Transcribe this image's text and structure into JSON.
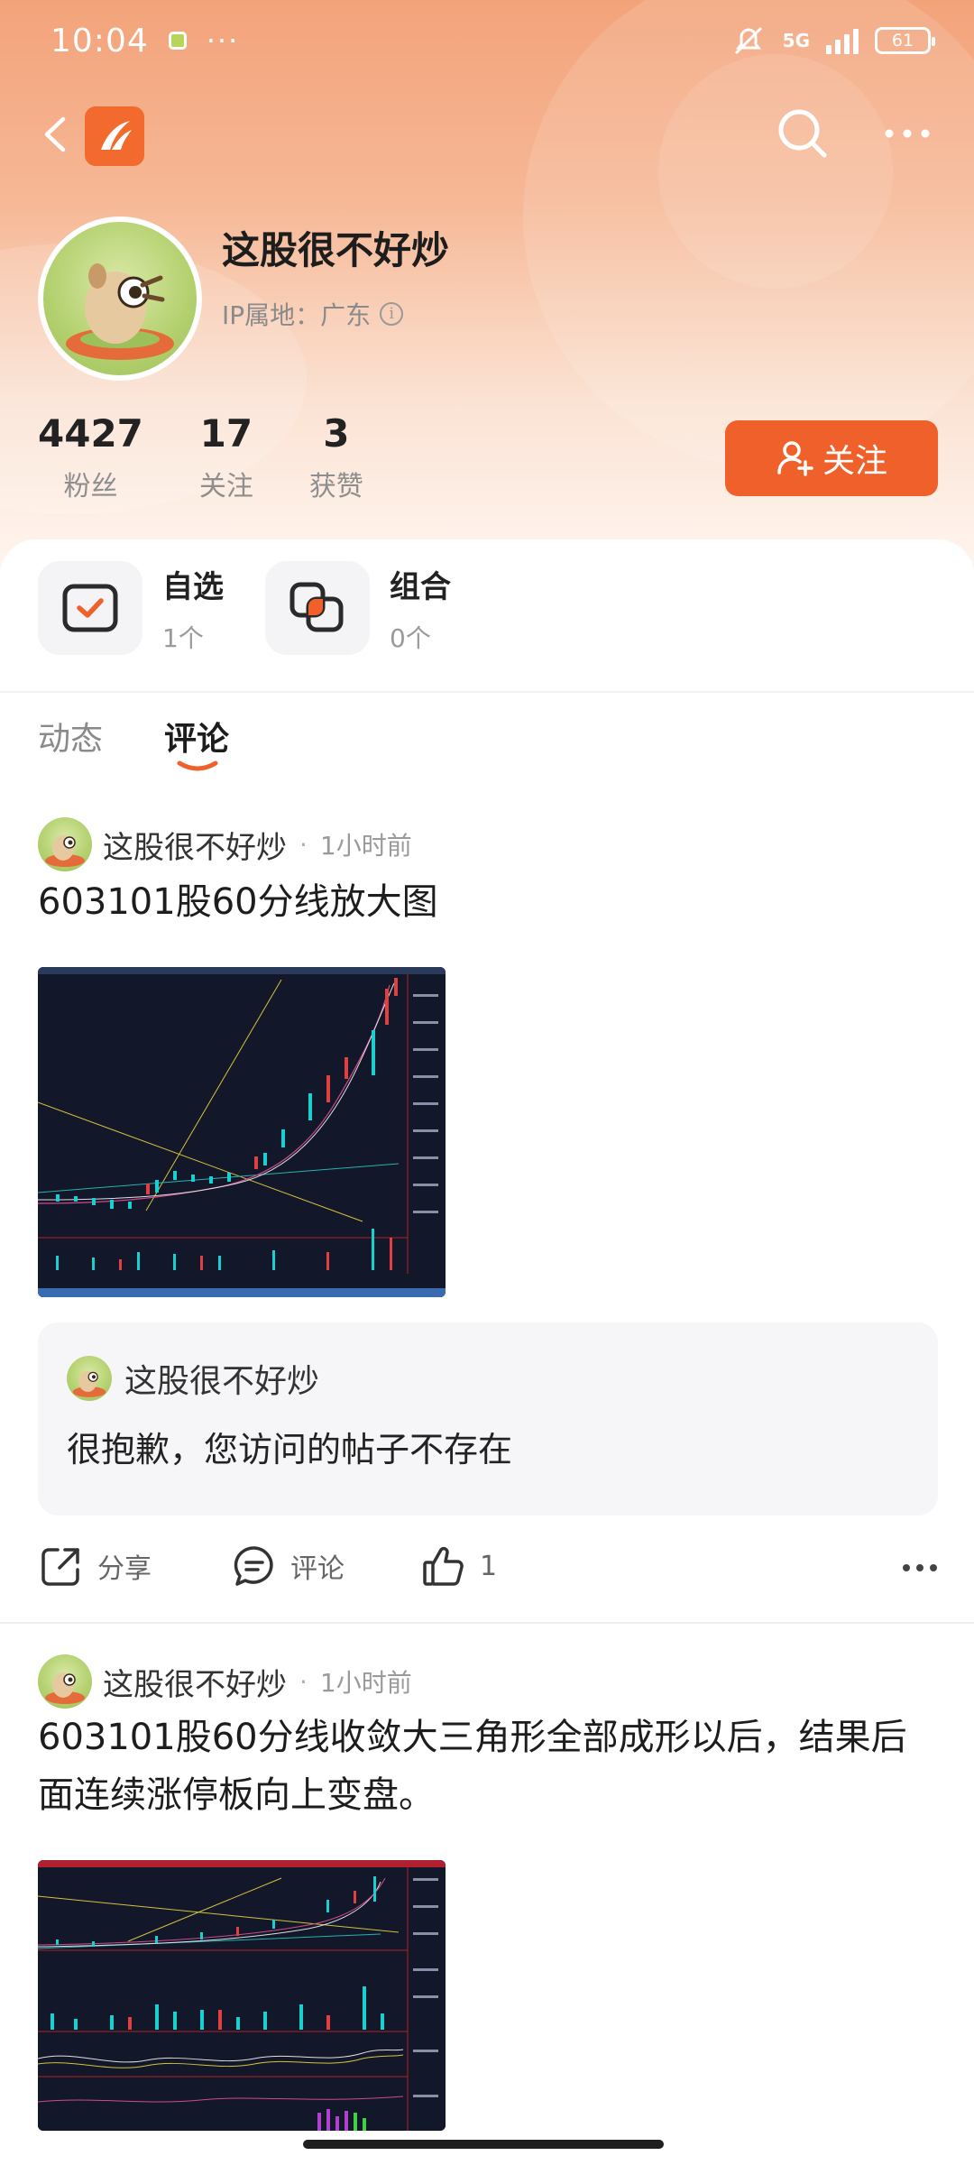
{
  "status_bar": {
    "time": "10:04",
    "network": "5G",
    "battery": "61"
  },
  "profile": {
    "name": "这股很不好炒",
    "ip_location": "IP属地：广东",
    "stats": [
      {
        "value": "4427",
        "label": "粉丝"
      },
      {
        "value": "17",
        "label": "关注"
      },
      {
        "value": "3",
        "label": "获赞"
      }
    ],
    "follow_label": "关注"
  },
  "quick_links": [
    {
      "title": "自选",
      "sub": "1个"
    },
    {
      "title": "组合",
      "sub": "0个"
    }
  ],
  "tabs": [
    {
      "label": "动态",
      "active": false
    },
    {
      "label": "评论",
      "active": true
    }
  ],
  "posts": [
    {
      "author": "这股很不好炒",
      "time": "1小时前",
      "text": "603101股60分线放大图",
      "quote": {
        "author": "这股很不好炒",
        "text": "很抱歉，您访问的帖子不存在"
      },
      "actions": {
        "share": "分享",
        "comment": "评论",
        "likes": "1"
      }
    },
    {
      "author": "这股很不好炒",
      "time": "1小时前",
      "text": "603101股60分线收敛大三角形全部成形以后，结果后面连续涨停板向上变盘。"
    }
  ],
  "colors": {
    "accent": "#f0602a",
    "hero_top": "#f3a37a",
    "chart_bg": "#12172a"
  },
  "icons": [
    "back-icon",
    "app-logo-icon",
    "search-icon",
    "more-icon",
    "info-icon",
    "add-user-icon",
    "watchlist-icon",
    "portfolio-icon",
    "share-icon",
    "comment-icon",
    "like-icon"
  ]
}
